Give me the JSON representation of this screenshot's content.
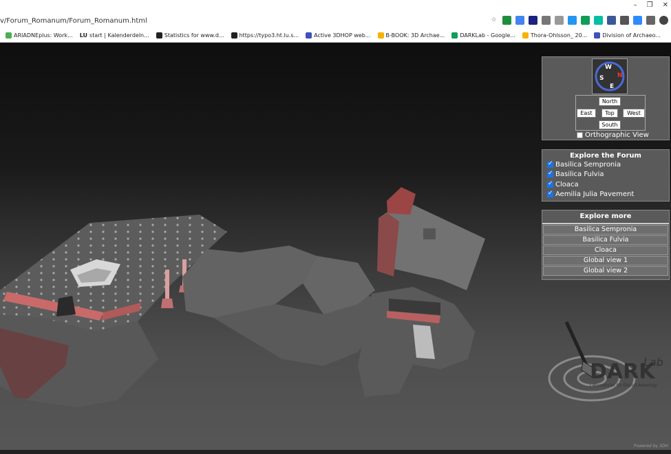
{
  "browser": {
    "url": "v/Forum_Romanum/Forum_Romanum.html",
    "window_controls": [
      "–",
      "❐",
      "✕"
    ],
    "bookmarks": [
      {
        "label": "ARIADNEplus: Work...",
        "color": "#4caf50"
      },
      {
        "label": "start | Kalenderdeln...",
        "color": "#222222",
        "prefix": "LU"
      },
      {
        "label": "Statistics for www.d...",
        "color": "#222222"
      },
      {
        "label": "https://typo3.ht.lu.s...",
        "color": "#222222"
      },
      {
        "label": "Active 3DHOP web...",
        "color": "#3f51b5"
      },
      {
        "label": "B-BOOK: 3D Archae...",
        "color": "#f4b400"
      },
      {
        "label": "DARKLab - Google...",
        "color": "#0f9d58"
      },
      {
        "label": "Thora-Ohlsson_ 20...",
        "color": "#f4b400"
      },
      {
        "label": "Division of Archaeo...",
        "color": "#3f51b5"
      }
    ]
  },
  "navigation": {
    "compass_letters": [
      "S",
      "W",
      "N",
      "E"
    ],
    "north_label": "North",
    "east_label": "East",
    "top_label": "Top",
    "west_label": "West",
    "south_label": "South",
    "orthographic_label": "Orthographic View",
    "orthographic_checked": false
  },
  "explore_forum": {
    "title": "Explore the Forum",
    "layers": [
      {
        "label": "Basilica Sempronia",
        "checked": true
      },
      {
        "label": "Basilica Fulvia",
        "checked": true
      },
      {
        "label": "Cloaca",
        "checked": true
      },
      {
        "label": "Aemilia Julia Pavement",
        "checked": true
      }
    ]
  },
  "explore_more": {
    "title": "Explore more",
    "buttons": [
      "Basilica Sempronia",
      "Basilica Fulvia",
      "Cloaca",
      "Global view 1",
      "Global view 2"
    ]
  },
  "logo": {
    "name": "DARK",
    "superscript": "Lab",
    "subtitle": "Laboratoriet för Digital Arkeologi"
  },
  "powered_by": "Powered by 3DH"
}
